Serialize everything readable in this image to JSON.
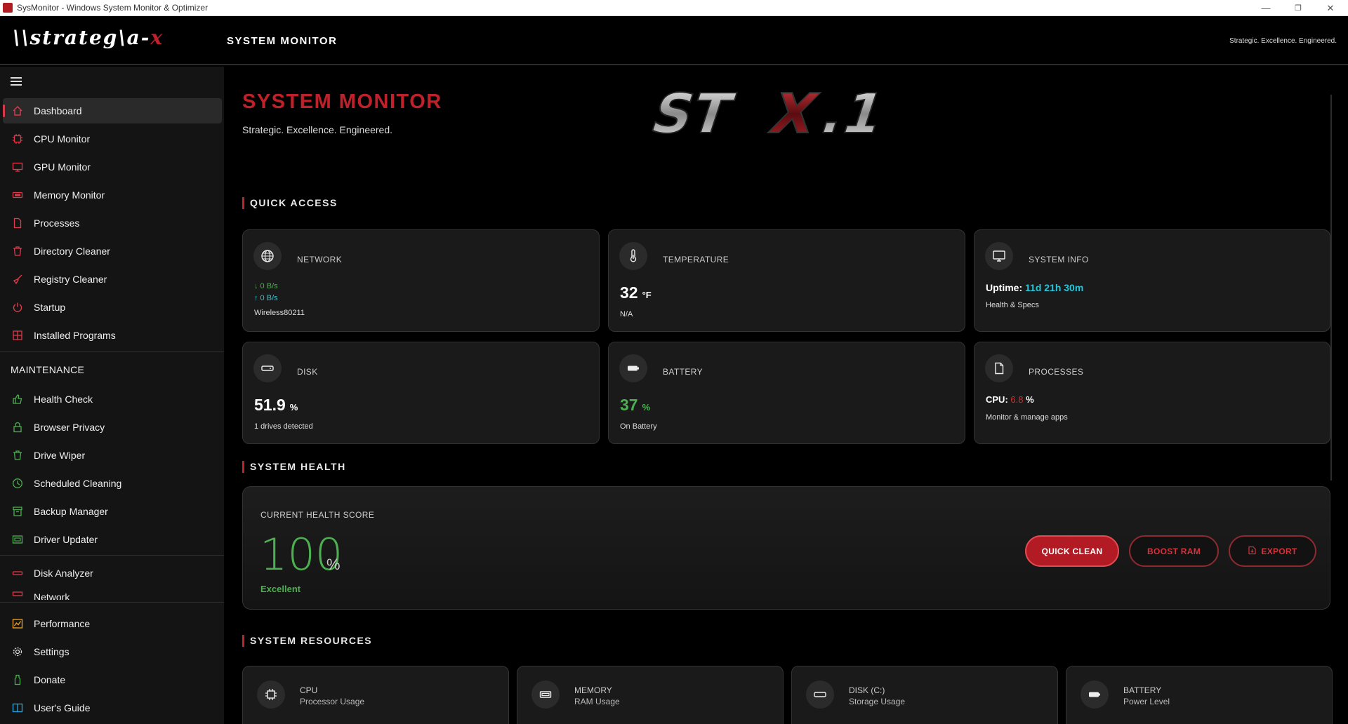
{
  "window": {
    "title": "SysMonitor - Windows System Monitor & Optimizer",
    "minimize": "—",
    "restore": "❐",
    "close": "✕"
  },
  "header": {
    "logo_text": "\\\\strateg\\a-",
    "logo_accent": "x",
    "title": "SYSTEM MONITOR",
    "tagline": "Strategic. Excellence. Engineered."
  },
  "sidebar": {
    "items": [
      {
        "label": "Dashboard",
        "icon": "home-icon"
      },
      {
        "label": "CPU Monitor",
        "icon": "cpu-icon"
      },
      {
        "label": "GPU Monitor",
        "icon": "monitor-icon"
      },
      {
        "label": "Memory Monitor",
        "icon": "memory-icon"
      },
      {
        "label": "Processes",
        "icon": "document-icon"
      },
      {
        "label": "Directory Cleaner",
        "icon": "trash-icon"
      },
      {
        "label": "Registry Cleaner",
        "icon": "broom-icon"
      },
      {
        "label": "Startup",
        "icon": "power-icon"
      },
      {
        "label": "Installed Programs",
        "icon": "apps-icon"
      }
    ],
    "maintenance_title": "MAINTENANCE",
    "maintenance_items": [
      {
        "label": "Health Check",
        "icon": "thumbs-up-icon"
      },
      {
        "label": "Browser Privacy",
        "icon": "lock-icon"
      },
      {
        "label": "Drive Wiper",
        "icon": "trash-icon"
      },
      {
        "label": "Scheduled Cleaning",
        "icon": "clock-icon"
      },
      {
        "label": "Backup Manager",
        "icon": "archive-icon"
      },
      {
        "label": "Driver Updater",
        "icon": "board-icon"
      }
    ],
    "tools_items": [
      {
        "label": "Disk Analyzer",
        "icon": "disk-icon"
      },
      {
        "label": "Network",
        "icon": "network-icon"
      }
    ],
    "bottom_items": [
      {
        "label": "Performance",
        "icon": "chart-icon"
      },
      {
        "label": "Settings",
        "icon": "gear-icon"
      },
      {
        "label": "Donate",
        "icon": "bottle-icon"
      },
      {
        "label": "User's Guide",
        "icon": "book-icon"
      }
    ]
  },
  "main": {
    "title": "SYSTEM MONITOR",
    "subtitle": "Strategic. Excellence. Engineered.",
    "brand_mark": "STX.1",
    "quick_access": {
      "heading": "QUICK ACCESS",
      "network": {
        "label": "NETWORK",
        "down": "↓ 0 B/s",
        "up": "↑ 0 B/s",
        "adapter": "Wireless80211"
      },
      "temperature": {
        "label": "TEMPERATURE",
        "value": "32",
        "unit": "°F",
        "note": "N/A"
      },
      "system_info": {
        "label": "SYSTEM INFO",
        "uptime_label": "Uptime:",
        "uptime_value": "11d 21h 30m",
        "note": "Health & Specs"
      },
      "disk": {
        "label": "DISK",
        "value": "51.9",
        "unit": "%",
        "note": "1 drives detected"
      },
      "battery": {
        "label": "BATTERY",
        "value": "37",
        "unit": "%",
        "note": "On Battery"
      },
      "processes": {
        "label": "PROCESSES",
        "cpu_label": "CPU:",
        "cpu_value": "6.8",
        "cpu_unit": "%",
        "note": "Monitor & manage apps"
      }
    },
    "system_health": {
      "heading": "SYSTEM HEALTH",
      "score_label": "CURRENT HEALTH SCORE",
      "score": "100",
      "score_unit": "%",
      "status": "Excellent",
      "buttons": {
        "quick_clean": "QUICK CLEAN",
        "boost_ram": "BOOST RAM",
        "export": "EXPORT"
      }
    },
    "system_resources": {
      "heading": "SYSTEM RESOURCES",
      "cards": [
        {
          "label": "CPU",
          "sub": "Processor Usage",
          "icon": "cpu-icon"
        },
        {
          "label": "MEMORY",
          "sub": "RAM Usage",
          "icon": "memory-icon"
        },
        {
          "label": "DISK (C:)",
          "sub": "Storage Usage",
          "icon": "disk-icon"
        },
        {
          "label": "BATTERY",
          "sub": "Power Level",
          "icon": "battery-icon"
        }
      ]
    }
  },
  "colors": {
    "accent": "#c0202a",
    "good": "#4caf50",
    "info": "#26c6da"
  }
}
